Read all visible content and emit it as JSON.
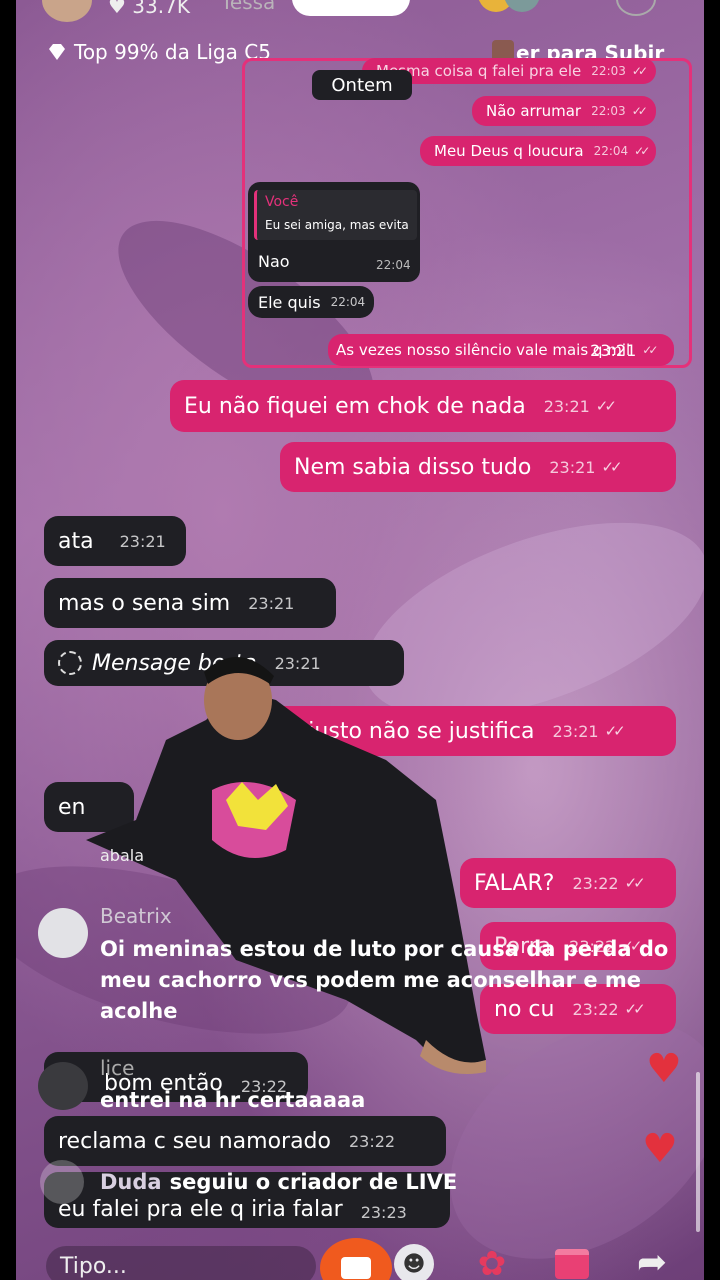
{
  "top": {
    "likes": "♥ 33.7K",
    "username": "Iessa",
    "league": "Top 99% da Liga C5",
    "subir": "er para Subir"
  },
  "screenshot": {
    "date_chip": "Ontem",
    "messages": [
      {
        "text": "Mesma coisa q falei pra ele",
        "time": "22:03"
      },
      {
        "text": "Não arrumar",
        "time": "22:03"
      },
      {
        "text": "Meu Deus q loucura",
        "time": "22:04"
      },
      {
        "quote_author": "Você",
        "quote_text": "Eu sei amiga, mas evita",
        "text": "Nao",
        "time": "22:04"
      },
      {
        "text": "Ele quis",
        "time": "22:04"
      },
      {
        "text": "As vezes nosso silêncio vale mais q mil",
        "time": "23:21"
      }
    ]
  },
  "chat": [
    {
      "text": "Eu não fiquei em chok de nada",
      "time": "23:21"
    },
    {
      "text": "Nem sabia disso tudo",
      "time": "23:21"
    },
    {
      "text": "ata",
      "time": "23:21"
    },
    {
      "text": "mas o sena sim",
      "time": "23:21"
    },
    {
      "text": "Mensage   berta",
      "time": "23:21"
    },
    {
      "text": "O justo não se justifica",
      "time": "23:21"
    },
    {
      "text": "en"
    },
    {
      "text": "FALAR?",
      "time": "23:22"
    },
    {
      "text": "Porra",
      "time": "23:22"
    },
    {
      "text": "no cu",
      "time": "23:22"
    },
    {
      "text": "bom então",
      "time": "23:22"
    },
    {
      "text": "reclama c seu namorado",
      "time": "23:22"
    },
    {
      "text": "eu falei pra ele q iria falar",
      "time": "23:23"
    }
  ],
  "live_comments": {
    "beatrix_name": "Beatrix",
    "beatrix_text": "Oi meninas estou de luto  por causa da perda do meu cachorro vcs podem me aconselhar e me acolhe",
    "alice_name": "lice",
    "alice_text": "entrei na hr certaaaaa",
    "follow_user": "Duda",
    "follow_text": "seguiu o criador de LIVE"
  },
  "partial_label": "abala",
  "input": {
    "placeholder": "Tipo..."
  },
  "colors": {
    "outgoing": "#d8246f",
    "incoming": "#1f1f24",
    "accent": "#e4317a"
  },
  "icons": [
    "heart-icon",
    "gem-icon",
    "gift-icon",
    "rose-icon",
    "share-icon",
    "emoji-icon",
    "camera-icon",
    "follow-icon",
    "phone-icon"
  ]
}
